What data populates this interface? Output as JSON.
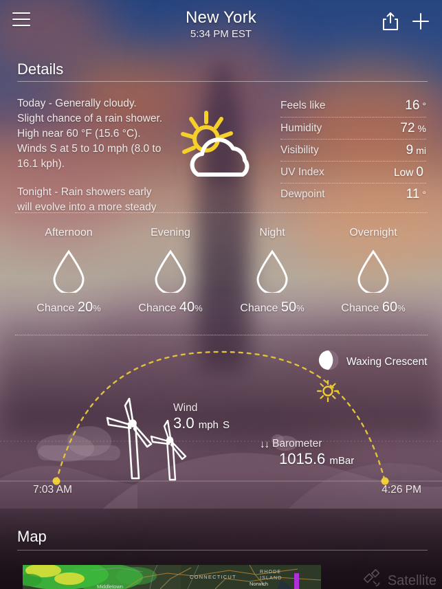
{
  "header": {
    "menu_icon": "hamburger-menu-icon",
    "city": "New York",
    "time": "5:34 PM EST",
    "share_icon": "share-icon",
    "add_icon": "plus-icon"
  },
  "details": {
    "title": "Details",
    "today_text": "Today - Generally cloudy. Slight chance of a rain shower. High near 60 °F (15.6 °C). Winds S at 5 to 10 mph (8.0 to 16.1 kph).",
    "tonight_text": "Tonight - Rain showers early will evolve into a more steady",
    "condition_icon": "sun-behind-cloud-icon",
    "stats": [
      {
        "label": "Feels like",
        "prefix": "",
        "value": "16",
        "unit": "°"
      },
      {
        "label": "Humidity",
        "prefix": "",
        "value": "72",
        "unit": "%"
      },
      {
        "label": "Visibility",
        "prefix": "",
        "value": "9",
        "unit": "mi"
      },
      {
        "label": "UV Index",
        "prefix": "Low",
        "value": "0",
        "unit": ""
      },
      {
        "label": "Dewpoint",
        "prefix": "",
        "value": "11",
        "unit": "°"
      }
    ]
  },
  "precipitation": {
    "icon": "raindrop-icon",
    "chance_label": "Chance",
    "percent_symbol": "%",
    "periods": [
      {
        "name": "Afternoon",
        "chance": "20"
      },
      {
        "name": "Evening",
        "chance": "40"
      },
      {
        "name": "Night",
        "chance": "50"
      },
      {
        "name": "Overnight",
        "chance": "60"
      }
    ]
  },
  "astronomy": {
    "moon_icon": "waxing-crescent-moon-icon",
    "moon_phase": "Waxing Crescent",
    "sun_marker_icon": "sun-icon",
    "turbine_icon": "wind-turbine-icon",
    "wind": {
      "label": "Wind",
      "value": "3.0",
      "unit": "mph",
      "direction": "S"
    },
    "barometer": {
      "arrows": "↓↓",
      "label": "Barometer",
      "value": "1015.6",
      "unit": "mBar"
    },
    "sunrise": "7:03 AM",
    "sunset": "4:26 PM"
  },
  "map": {
    "title": "Map",
    "satellite_label": "Satellite",
    "satellite_icon": "satellite-icon",
    "region_labels": [
      "CONNECTICUT",
      "RHODE ISLAND",
      "Norwich",
      "Middletown"
    ]
  },
  "colors": {
    "accent_yellow": "#e8c840",
    "sun_yellow": "#f2cc22",
    "text_primary": "#ffffff",
    "radar_green": "#3fbf3f",
    "radar_yellow": "#e8e83a"
  }
}
